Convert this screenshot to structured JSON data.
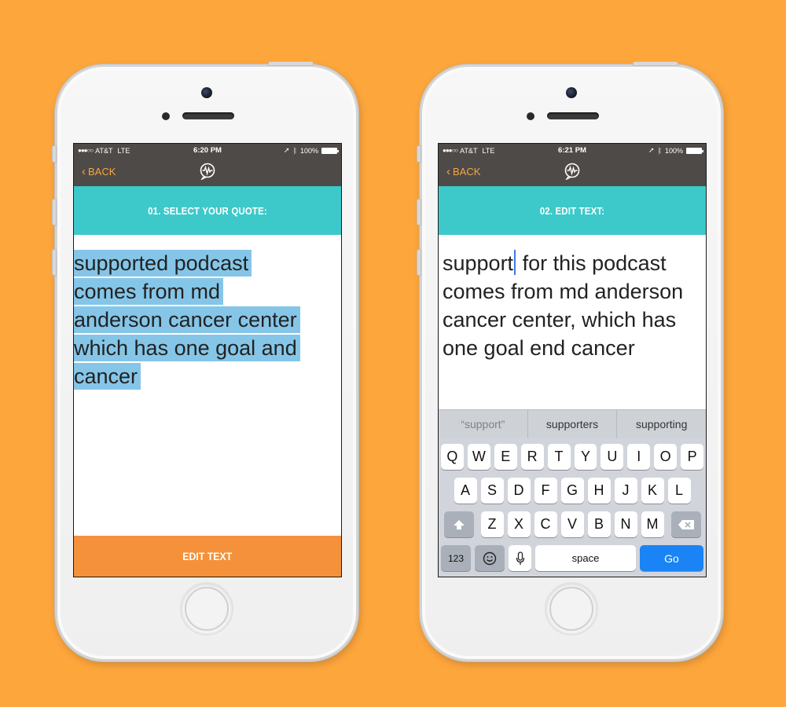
{
  "left_phone": {
    "status": {
      "carrier": "AT&T",
      "network": "LTE",
      "time": "6:20 PM",
      "battery": "100%"
    },
    "nav": {
      "back_label": "BACK",
      "back_icon": "chevron-left-icon",
      "logo_icon": "waveform-chat-logo"
    },
    "section_title": "01. SELECT YOUR QUOTE:",
    "quote_lines": [
      "supported podcast",
      "comes from md",
      "anderson cancer center",
      "which has one goal and",
      "cancer"
    ],
    "action_button": "EDIT TEXT"
  },
  "right_phone": {
    "status": {
      "carrier": "AT&T",
      "network": "LTE",
      "time": "6:21 PM",
      "battery": "100%"
    },
    "nav": {
      "back_label": "BACK",
      "back_icon": "chevron-left-icon",
      "logo_icon": "waveform-chat-logo"
    },
    "section_title": "02. EDIT TEXT:",
    "text_before_cursor": "support",
    "text_after_cursor": " for this podcast comes from md anderson cancer center, which has one goal end cancer",
    "suggestions": [
      "“support”",
      "supporters",
      "supporting"
    ],
    "keyboard": {
      "row1": [
        "Q",
        "W",
        "E",
        "R",
        "T",
        "Y",
        "U",
        "I",
        "O",
        "P"
      ],
      "row2": [
        "A",
        "S",
        "D",
        "F",
        "G",
        "H",
        "J",
        "K",
        "L"
      ],
      "row3": [
        "Z",
        "X",
        "C",
        "V",
        "B",
        "N",
        "M"
      ],
      "num_key": "123",
      "space_key": "space",
      "go_key": "Go",
      "shift_icon": "shift-arrow-icon",
      "delete_icon": "backspace-icon",
      "emoji_icon": "emoji-icon",
      "mic_icon": "microphone-icon"
    }
  },
  "colors": {
    "background": "#FDA63C",
    "nav": "#4E4A48",
    "accent_orange": "#F5A742",
    "section_teal": "#3DC9C9",
    "selection_blue": "#85C6E8",
    "button_orange": "#F4913A",
    "go_blue": "#1A84F6"
  }
}
